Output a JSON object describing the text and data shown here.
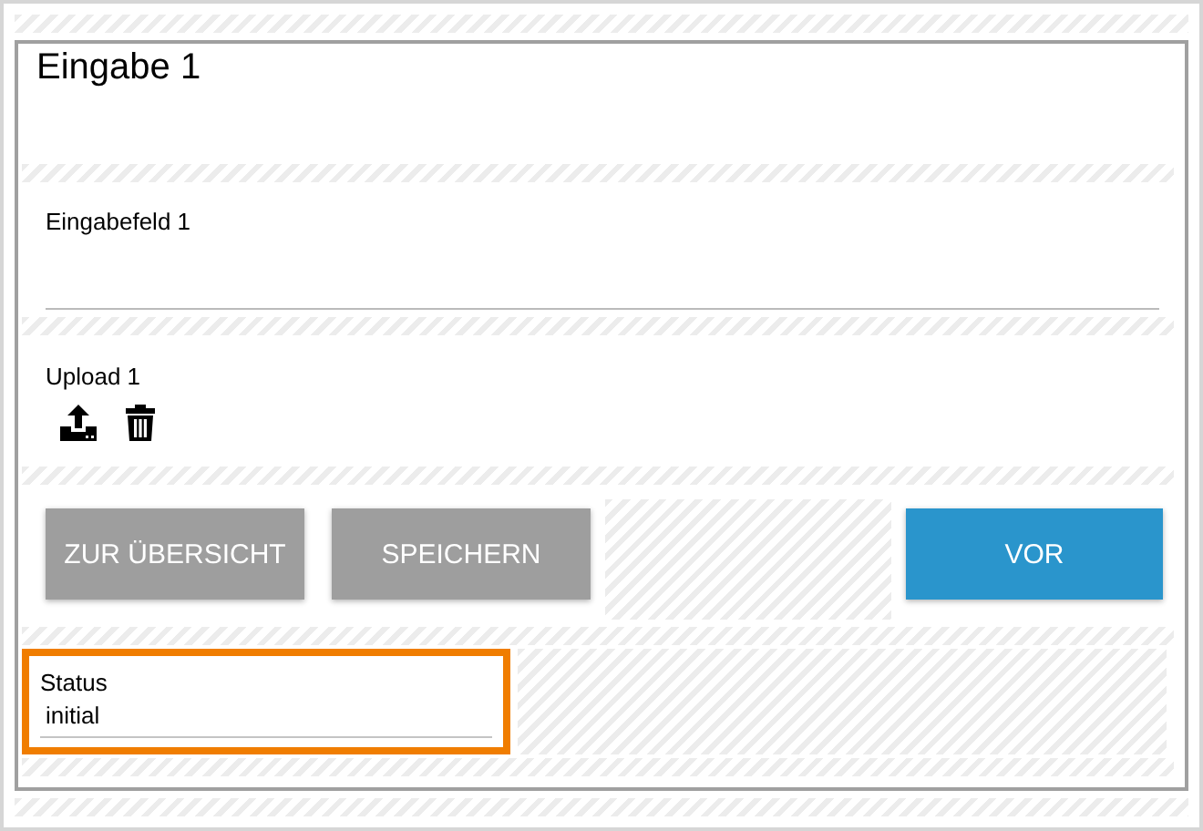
{
  "panel": {
    "title": "Eingabe 1"
  },
  "input_field": {
    "label": "Eingabefeld 1"
  },
  "upload": {
    "label": "Upload 1"
  },
  "buttons": [
    {
      "kind": "default",
      "label": "ZUR ÜBERSICHT"
    },
    {
      "kind": "default",
      "label": "SPEICHERN"
    },
    {
      "kind": "spacer"
    },
    {
      "kind": "primary",
      "label": "VOR"
    }
  ],
  "status": {
    "label": "Status",
    "value": "initial",
    "highlighted": true
  }
}
